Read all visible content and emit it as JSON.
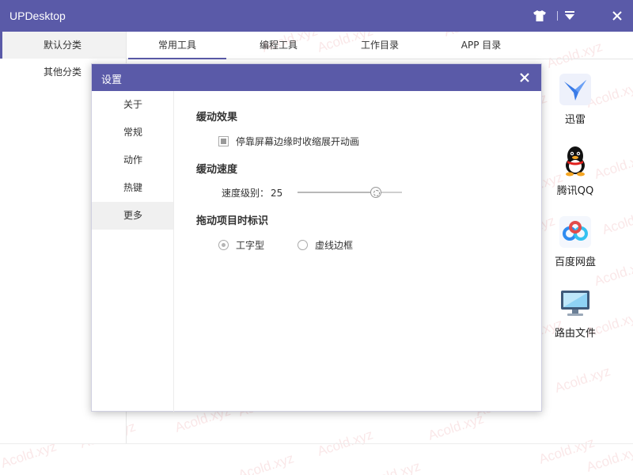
{
  "window": {
    "title": "UPDesktop"
  },
  "sidebar": {
    "items": [
      {
        "label": "默认分类"
      },
      {
        "label": "其他分类"
      }
    ]
  },
  "tabs": [
    {
      "label": "常用工具"
    },
    {
      "label": "编程工具"
    },
    {
      "label": "工作目录"
    },
    {
      "label": "APP 目录"
    }
  ],
  "apps": [
    {
      "label": "迅雷",
      "icon": "thunder-bird-icon"
    },
    {
      "label": "腾讯QQ",
      "icon": "qq-penguin-icon"
    },
    {
      "label": "百度网盘",
      "icon": "baidu-cloud-icon"
    },
    {
      "label": "路由文件",
      "icon": "monitor-icon"
    }
  ],
  "dialog": {
    "title": "设置",
    "nav": [
      {
        "label": "关于"
      },
      {
        "label": "常规"
      },
      {
        "label": "动作"
      },
      {
        "label": "热键"
      },
      {
        "label": "更多"
      }
    ],
    "active_nav": "更多",
    "easing_effect": {
      "title": "缓动效果",
      "checkbox_label": "停靠屏幕边缘时收缩展开动画",
      "checked": true
    },
    "easing_speed": {
      "title": "缓动速度",
      "speed_label": "速度级别：",
      "speed_value": "25",
      "slider_fraction": 0.75
    },
    "drag_marker": {
      "title": "拖动项目时标识",
      "options": [
        {
          "label": "工字型",
          "selected": true
        },
        {
          "label": "虚线边框",
          "selected": false
        }
      ]
    }
  },
  "watermark": "Acold.xyz",
  "colors": {
    "accent": "#5a5aa8",
    "watermark": "#e67882"
  }
}
